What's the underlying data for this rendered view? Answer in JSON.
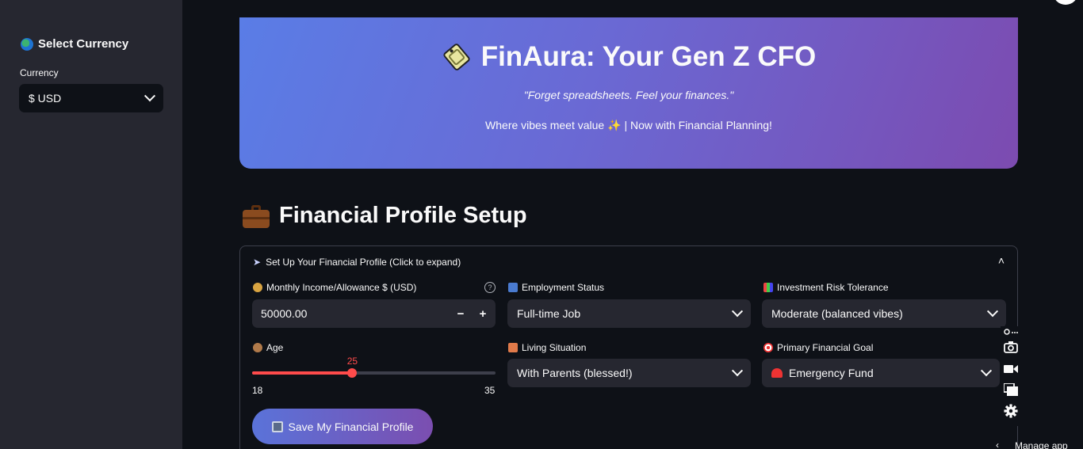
{
  "sidebar": {
    "title": "Select Currency",
    "currency_label": "Currency",
    "currency_value": "$ USD"
  },
  "hero": {
    "title": "FinAura: Your Gen Z CFO",
    "quote": "\"Forget spreadsheets. Feel your finances.\"",
    "sub_before": "Where vibes meet value",
    "sub_after": "| Now with Financial Planning!"
  },
  "section": {
    "title": "Financial Profile Setup"
  },
  "expander": {
    "header": "Set Up Your Financial Profile (Click to expand)"
  },
  "fields": {
    "income_label": "Monthly Income/Allowance $ (USD)",
    "income_value": "50000.00",
    "minus": "−",
    "plus": "+",
    "help": "?",
    "employment_label": "Employment Status",
    "employment_value": "Full-time Job",
    "risk_label": "Investment Risk Tolerance",
    "risk_value": "Moderate (balanced vibes)",
    "age_label": "Age",
    "age_value": "25",
    "age_min": "18",
    "age_max": "35",
    "living_label": "Living Situation",
    "living_value": "With Parents (blessed!)",
    "goal_label": "Primary Financial Goal",
    "goal_value": "Emergency Fund"
  },
  "age_slider": {
    "min": 18,
    "max": 35,
    "value": 25
  },
  "save_button": "Save My Financial Profile",
  "manage_app": "Manage app",
  "colors": {
    "accent": "#ff4b4b",
    "sidebar_bg": "#262730",
    "app_bg": "#0e1117",
    "gradient_start": "#5a7de6",
    "gradient_end": "#7c4bb0"
  }
}
